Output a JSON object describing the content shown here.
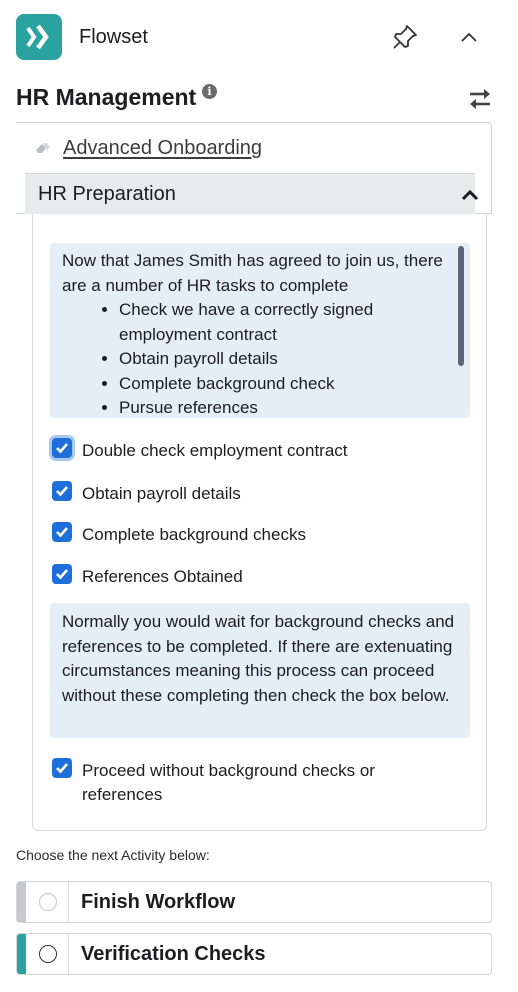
{
  "header": {
    "app_name": "Flowset",
    "icons": {
      "logo": "flowset-logo-icon",
      "pin": "pin-icon",
      "collapse": "chevron-up-icon"
    },
    "brand_color": "#2aa3a0"
  },
  "section": {
    "title": "HR Management",
    "icons": {
      "info": "info-icon",
      "swap": "swap-arrows-icon"
    }
  },
  "workflow": {
    "name": "Advanced Onboarding",
    "icon": "eraser-icon"
  },
  "activity": {
    "title": "HR Preparation",
    "icon": "chevron-up-icon",
    "intro": "Now that James Smith has agreed to join us, there are a number of HR tasks to complete",
    "bullets": [
      "Check we have a correctly signed employment contract",
      "Obtain payroll details",
      "Complete background check",
      "Pursue references"
    ],
    "checkboxes": [
      {
        "label": "Double check employment contract",
        "checked": true
      },
      {
        "label": "Obtain payroll details",
        "checked": true
      },
      {
        "label": "Complete background checks",
        "checked": true
      },
      {
        "label": "References Obtained",
        "checked": true
      }
    ],
    "note": "Normally you would wait for background checks and references to be completed.  If there are extenuating circumstances meaning this process can proceed without these completing then check the box below.",
    "proceed": {
      "label": "Proceed without background checks or references",
      "checked": true
    }
  },
  "next": {
    "label": "Choose the next Activity below:",
    "options": [
      {
        "label": "Finish Workflow",
        "accent": "#c6c8cc",
        "enabled": false
      },
      {
        "label": "Verification Checks",
        "accent": "#2aa3a0",
        "enabled": true
      }
    ]
  },
  "colors": {
    "accent": "#2aa3a0",
    "checkbox": "#1e6fd9",
    "info_bg": "#e4eef7"
  }
}
